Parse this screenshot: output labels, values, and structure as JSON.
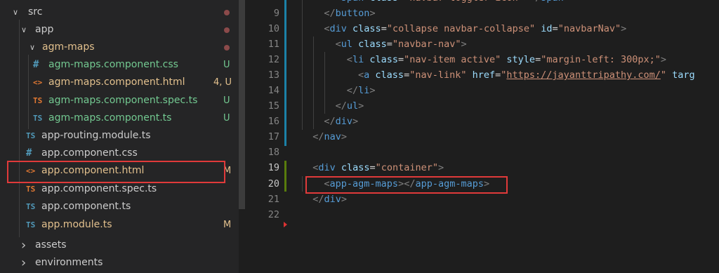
{
  "explorer": {
    "items": [
      {
        "label": "src",
        "type": "folder",
        "open": true,
        "color": "#cccccc",
        "dot": true
      },
      {
        "label": "app",
        "type": "folder",
        "open": true,
        "color": "#cccccc",
        "dot": true
      },
      {
        "label": "agm-maps",
        "type": "folder",
        "open": true,
        "color": "#e2c08d",
        "dot": true
      },
      {
        "label": "agm-maps.component.css",
        "icon": "#",
        "icon_name": "css-file-icon",
        "icon_color": "#519aba",
        "color": "#73c991",
        "badge": "U",
        "badge_color": "#73c991"
      },
      {
        "label": "agm-maps.component.html",
        "icon": "<>",
        "icon_name": "html-file-icon",
        "icon_color": "#e37933",
        "color": "#e2c08d",
        "badge": "4, U",
        "badge_color": "#e2c08d"
      },
      {
        "label": "agm-maps.component.spec.ts",
        "icon": "TS",
        "icon_name": "ts-spec-file-icon",
        "icon_color": "#e37933",
        "color": "#73c991",
        "badge": "U",
        "badge_color": "#73c991"
      },
      {
        "label": "agm-maps.component.ts",
        "icon": "TS",
        "icon_name": "ts-file-icon",
        "icon_color": "#519aba",
        "color": "#73c991",
        "badge": "U",
        "badge_color": "#73c991"
      },
      {
        "label": "app-routing.module.ts",
        "icon": "TS",
        "icon_name": "ts-file-icon",
        "icon_color": "#519aba",
        "color": "#cccccc"
      },
      {
        "label": "app.component.css",
        "icon": "#",
        "icon_name": "css-file-icon",
        "icon_color": "#519aba",
        "color": "#cccccc"
      },
      {
        "label": "app.component.html",
        "icon": "<>",
        "icon_name": "html-file-icon",
        "icon_color": "#e37933",
        "color": "#e2c08d",
        "badge": "M",
        "badge_color": "#e2c08d"
      },
      {
        "label": "app.component.spec.ts",
        "icon": "TS",
        "icon_name": "ts-spec-file-icon",
        "icon_color": "#e37933",
        "color": "#cccccc"
      },
      {
        "label": "app.component.ts",
        "icon": "TS",
        "icon_name": "ts-file-icon",
        "icon_color": "#519aba",
        "color": "#cccccc"
      },
      {
        "label": "app.module.ts",
        "icon": "TS",
        "icon_name": "ts-file-icon",
        "icon_color": "#519aba",
        "color": "#e2c08d",
        "badge": "M",
        "badge_color": "#e2c08d"
      },
      {
        "label": "assets",
        "type": "folder",
        "open": false,
        "color": "#cccccc"
      },
      {
        "label": "environments",
        "type": "folder",
        "open": false,
        "color": "#cccccc"
      }
    ]
  },
  "editor": {
    "lines": [
      {
        "n": "9",
        "tokens": [
          [
            "tk-punc",
            "</"
          ],
          [
            "tk-tag",
            "button"
          ],
          [
            "tk-punc",
            ">"
          ]
        ]
      },
      {
        "n": "10",
        "tokens": [
          [
            "tk-punc",
            "<"
          ],
          [
            "tk-tag",
            "div"
          ],
          [
            "",
            ""
          ],
          [
            "tk-attr",
            " class"
          ],
          [
            "",
            "="
          ],
          [
            "tk-str",
            "\"collapse navbar-collapse\""
          ],
          [
            "tk-attr",
            " id"
          ],
          [
            "",
            "="
          ],
          [
            "tk-str",
            "\"navbarNav\""
          ],
          [
            "tk-punc",
            ">"
          ]
        ]
      },
      {
        "n": "11",
        "tokens": [
          [
            "tk-punc",
            "<"
          ],
          [
            "tk-tag",
            "ul"
          ],
          [
            "tk-attr",
            " class"
          ],
          [
            "",
            "="
          ],
          [
            "tk-str",
            "\"navbar-nav\""
          ],
          [
            "tk-punc",
            ">"
          ]
        ]
      },
      {
        "n": "12",
        "tokens": [
          [
            "tk-punc",
            "<"
          ],
          [
            "tk-tag",
            "li"
          ],
          [
            "tk-attr",
            " class"
          ],
          [
            "",
            "="
          ],
          [
            "tk-str",
            "\"nav-item active\""
          ],
          [
            "tk-attr",
            " style"
          ],
          [
            "",
            "="
          ],
          [
            "tk-str",
            "\"margin-left: 300px;\""
          ],
          [
            "tk-punc",
            ">"
          ]
        ]
      },
      {
        "n": "13",
        "tokens": [
          [
            "tk-punc",
            "<"
          ],
          [
            "tk-tag",
            "a"
          ],
          [
            "tk-attr",
            " class"
          ],
          [
            "",
            "="
          ],
          [
            "tk-str",
            "\"nav-link\""
          ],
          [
            "tk-attr",
            " href"
          ],
          [
            "",
            "="
          ],
          [
            "tk-str",
            "\""
          ],
          [
            "tk-url",
            "https://jayanttripathy.com/"
          ],
          [
            "tk-str",
            "\""
          ],
          [
            "tk-attr",
            " targ"
          ]
        ]
      },
      {
        "n": "14",
        "tokens": [
          [
            "tk-punc",
            "</"
          ],
          [
            "tk-tag",
            "li"
          ],
          [
            "tk-punc",
            ">"
          ]
        ]
      },
      {
        "n": "15",
        "tokens": [
          [
            "tk-punc",
            "</"
          ],
          [
            "tk-tag",
            "ul"
          ],
          [
            "tk-punc",
            ">"
          ]
        ]
      },
      {
        "n": "16",
        "tokens": [
          [
            "tk-punc",
            "</"
          ],
          [
            "tk-tag",
            "div"
          ],
          [
            "tk-punc",
            ">"
          ]
        ]
      },
      {
        "n": "17",
        "tokens": [
          [
            "tk-punc",
            "</"
          ],
          [
            "tk-tag",
            "nav"
          ],
          [
            "tk-punc",
            ">"
          ]
        ]
      },
      {
        "n": "18",
        "tokens": []
      },
      {
        "n": "19",
        "tokens": [
          [
            "tk-punc",
            "<"
          ],
          [
            "tk-tag",
            "div"
          ],
          [
            "tk-attr",
            " class"
          ],
          [
            "",
            "="
          ],
          [
            "tk-str",
            "\"container\""
          ],
          [
            "tk-punc",
            ">"
          ]
        ]
      },
      {
        "n": "20",
        "tokens": [
          [
            "tk-punc",
            "<"
          ],
          [
            "tk-tag",
            "app-agm-maps"
          ],
          [
            "tk-punc",
            "></"
          ],
          [
            "tk-tag",
            "app-agm-maps"
          ],
          [
            "tk-punc",
            ">"
          ]
        ]
      },
      {
        "n": "21",
        "tokens": [
          [
            "tk-punc",
            "</"
          ],
          [
            "tk-tag",
            "div"
          ],
          [
            "tk-punc",
            ">"
          ]
        ]
      },
      {
        "n": "22",
        "tokens": []
      }
    ],
    "partial_top_line": [
      [
        "tk-punc",
        "<"
      ],
      [
        "tk-tag",
        "span"
      ],
      [
        "tk-attr",
        " class"
      ],
      [
        "",
        "="
      ],
      [
        "tk-str",
        "\"navbar-toggler-icon\""
      ],
      [
        "tk-punc",
        "></"
      ],
      [
        "tk-tag",
        "span"
      ],
      [
        "tk-punc",
        ">"
      ]
    ]
  },
  "colors": {
    "highlight": "#e03a3a",
    "modified": "#e2c08d",
    "untracked": "#73c991"
  }
}
